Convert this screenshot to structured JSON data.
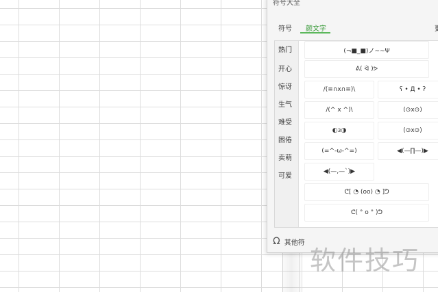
{
  "dialog": {
    "title": "符号大全",
    "tabs": [
      {
        "label": "符号",
        "active": false
      },
      {
        "label": "颜文字",
        "active": true
      }
    ],
    "more_tab": "更",
    "categories": [
      "热门",
      "开心",
      "惊讶",
      "生气",
      "难受",
      "困倦",
      "卖萌",
      "可爱"
    ],
    "active_category": "热门",
    "emoticons": [
      "(¬■_■)ノ~~Ψ",
      "ᕕ( ᐛ )ᕗ",
      "/(≡∩x∩≡)\\",
      "ʕ • Д • ʔ",
      "/(^ x ^)\\",
      "(⊙x⊙)",
      "◐з◑",
      "(⊙x⊙)",
      "(=^-ω-^=)",
      "◀(—∏—)▶",
      "◀(—,—`)▶",
      "ᕦ[ ◔ (oo) ◔ ]ᕤ",
      "ᕦ( ° o ° )ᕤ"
    ],
    "footer_label": "其他符"
  },
  "watermark": "软件技巧"
}
